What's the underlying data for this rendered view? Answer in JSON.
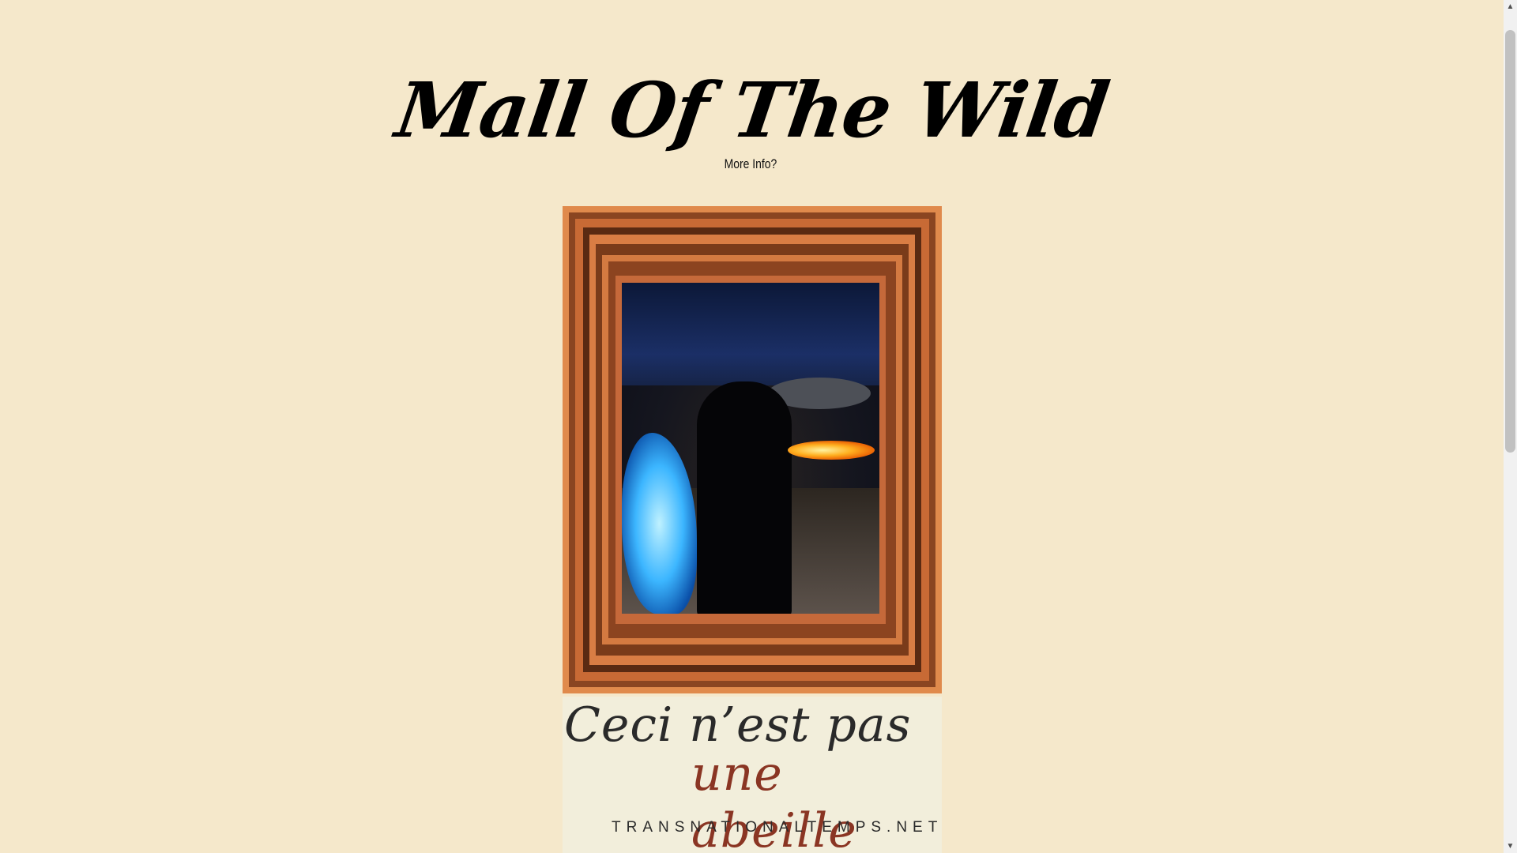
{
  "header": {
    "title": "Mall Of The Wild",
    "more_info_label": "More Info?"
  },
  "artwork": {
    "frame_colors": [
      "#e08a4c",
      "#8a4521",
      "#c86a35",
      "#5a2a12"
    ]
  },
  "caption": {
    "line1": "Ceci n’est pas",
    "line2": "une abeille",
    "url": "TRANSNATIONALTEMPS.NET"
  },
  "scrollbar": {
    "up_icon": "▲",
    "down_icon": "▼",
    "position_fraction": 0.0
  }
}
